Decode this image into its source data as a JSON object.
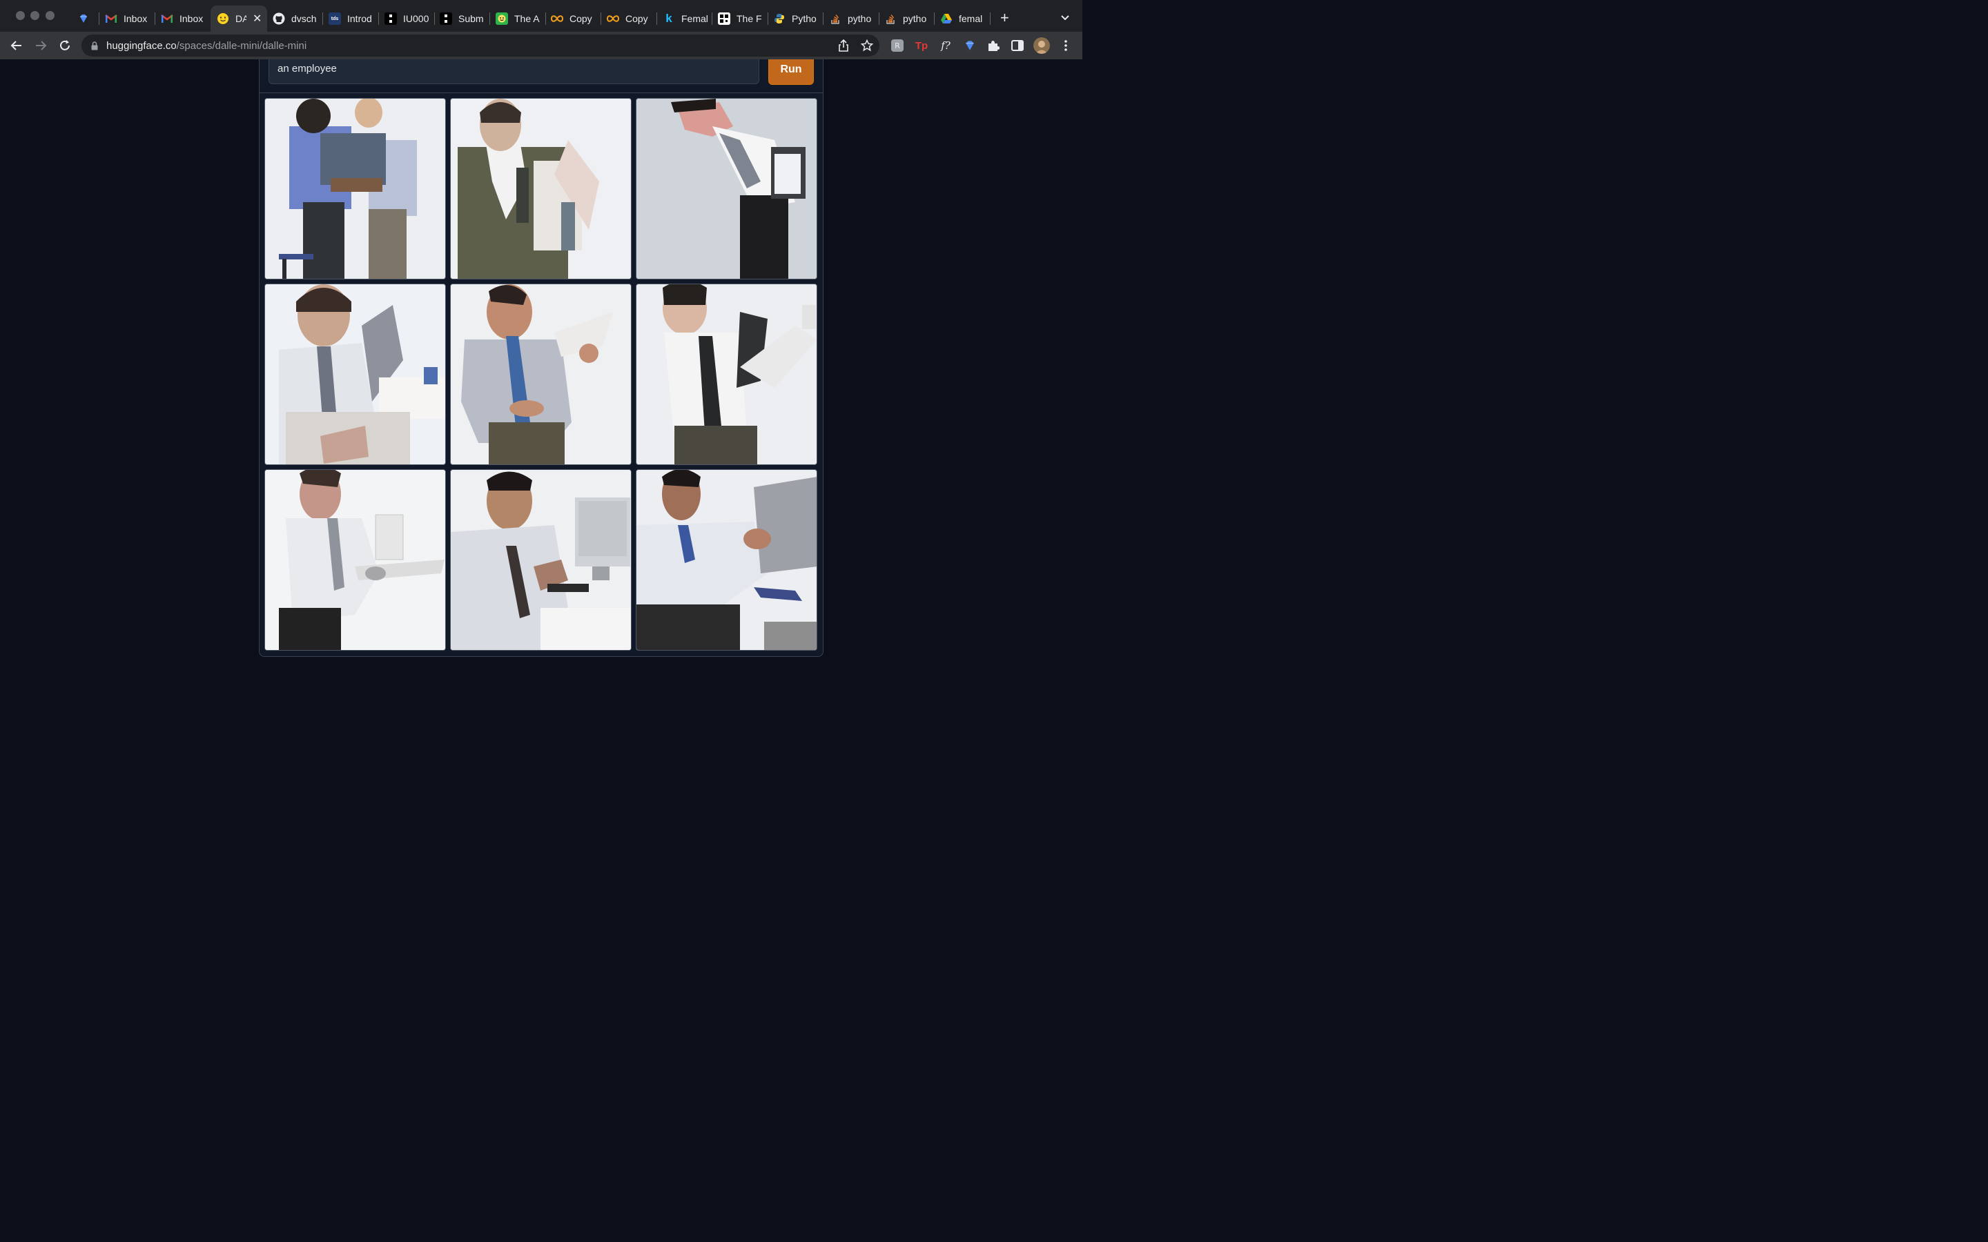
{
  "browser": {
    "tabs": [
      {
        "title": "",
        "icon": "diamond-icon"
      },
      {
        "title": "Inbox",
        "icon": "gmail-icon"
      },
      {
        "title": "Inbox",
        "icon": "gmail-icon"
      },
      {
        "title": "DA",
        "icon": "hugging-face-icon",
        "active": true
      },
      {
        "title": "dvsch",
        "icon": "github-icon"
      },
      {
        "title": "Introd",
        "icon": "tds-icon"
      },
      {
        "title": "IU000",
        "icon": "black-square-icon"
      },
      {
        "title": "Subm",
        "icon": "black-square-icon"
      },
      {
        "title": "The A",
        "icon": "green-face-icon"
      },
      {
        "title": "Copy",
        "icon": "infinity-icon"
      },
      {
        "title": "Copy",
        "icon": "infinity-icon"
      },
      {
        "title": "Femal",
        "icon": "kaggle-icon"
      },
      {
        "title": "The F",
        "icon": "qr-icon"
      },
      {
        "title": "Pytho",
        "icon": "python-icon"
      },
      {
        "title": "pytho",
        "icon": "stackoverflow-icon"
      },
      {
        "title": "pytho",
        "icon": "stackoverflow-icon"
      },
      {
        "title": "femal",
        "icon": "google-drive-icon"
      }
    ],
    "new_tab": "+",
    "url_host": "huggingface.co",
    "url_path": "/spaces/dalle-mini/dalle-mini",
    "tab_icons_text": {
      "tds": "tds",
      "kaggle": "k"
    },
    "extensions": [
      "share-icon",
      "star-icon",
      "extension-r-icon",
      "extension-tp-icon",
      "extension-f-icon",
      "diamond-icon",
      "puzzle-icon",
      "side-panel-icon",
      "profile-avatar",
      "kebab-menu-icon"
    ],
    "ext_labels": {
      "tp": "Tp",
      "f": "f?"
    }
  },
  "app": {
    "prompt_value": "an employee",
    "run_label": "Run",
    "images": [
      {
        "description": "generated image 1"
      },
      {
        "description": "generated image 2"
      },
      {
        "description": "generated image 3"
      },
      {
        "description": "generated image 4"
      },
      {
        "description": "generated image 5"
      },
      {
        "description": "generated image 6"
      },
      {
        "description": "generated image 7"
      },
      {
        "description": "generated image 8"
      },
      {
        "description": "generated image 9"
      }
    ]
  },
  "colors": {
    "page_bg": "#0b0f19",
    "panel_bg": "#111827",
    "run_button": "#c2681d",
    "tabstrip": "#202124",
    "toolbar": "#35363a"
  }
}
